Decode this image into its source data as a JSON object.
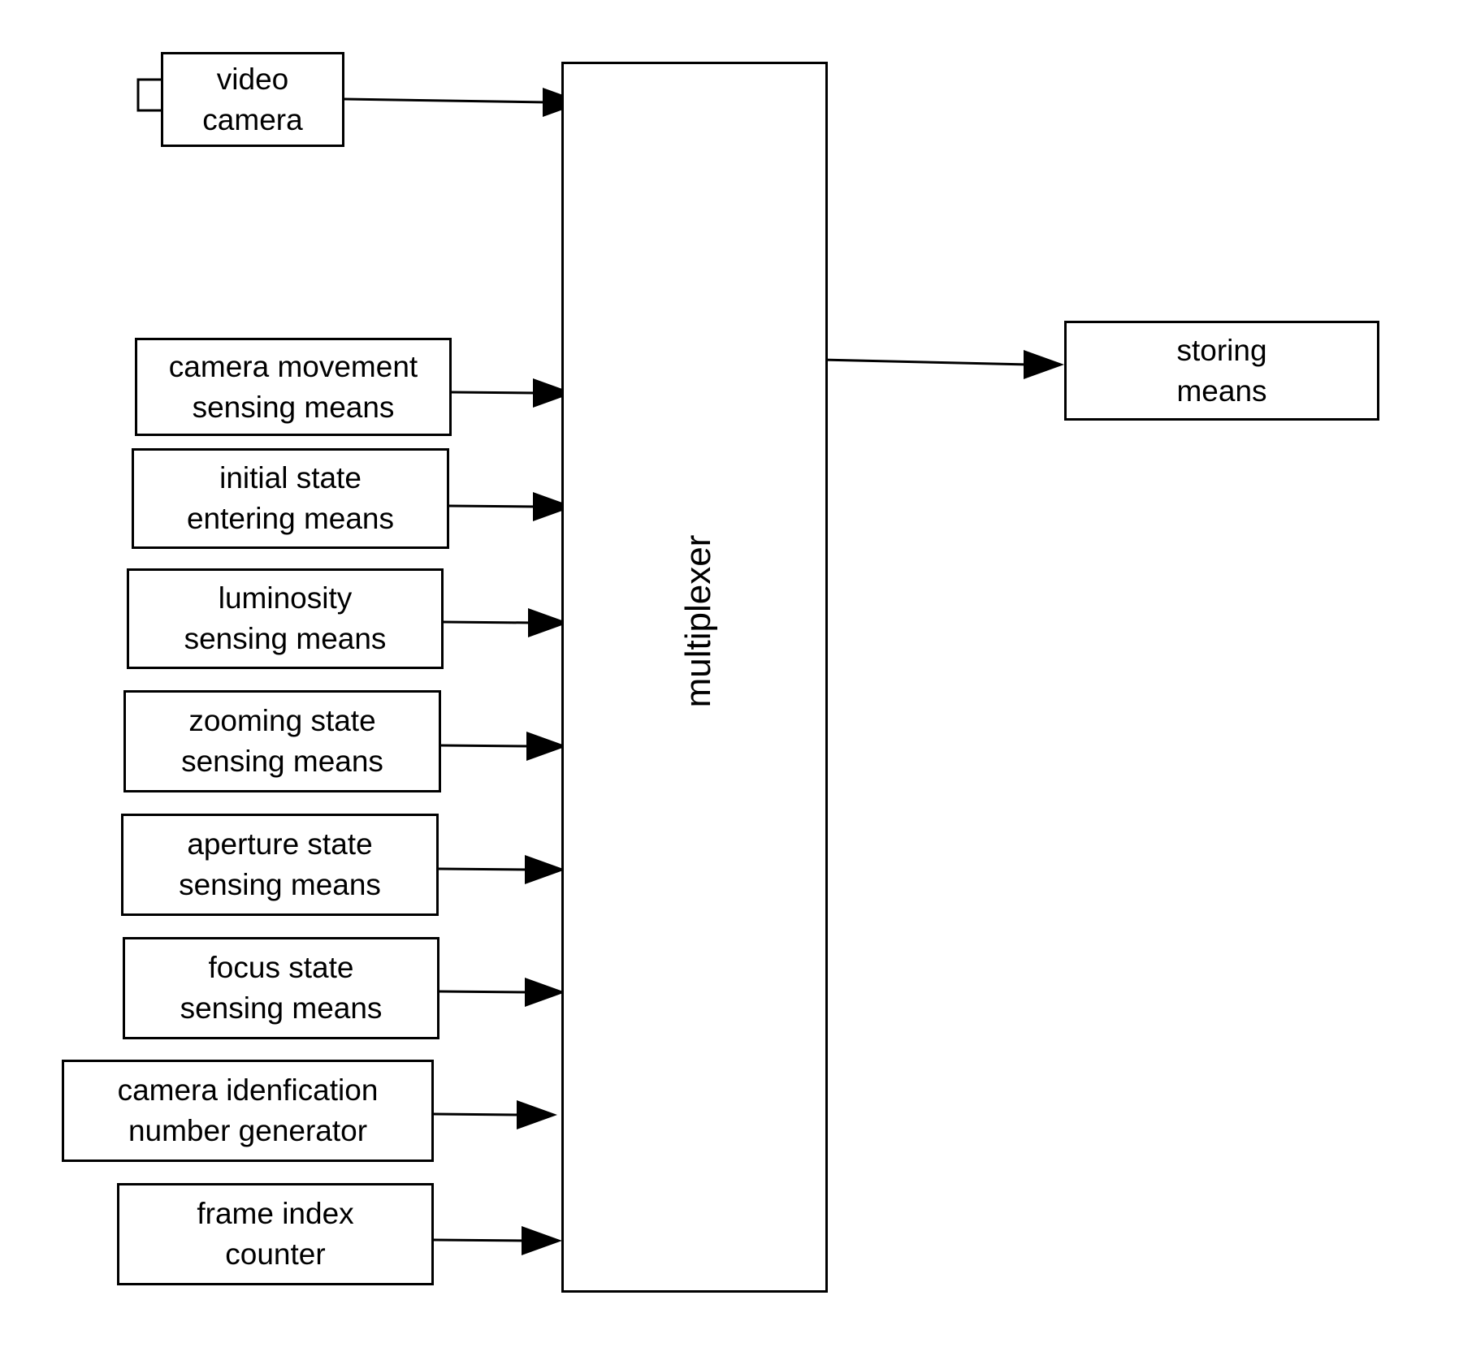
{
  "diagram": {
    "source": {
      "id": "video-camera",
      "lines": [
        "video",
        "camera"
      ],
      "icon": "camera-lens-icon"
    },
    "inputs": [
      {
        "id": "camera-movement-sensing-means",
        "lines": [
          "camera movement",
          "sensing means"
        ]
      },
      {
        "id": "initial-state-entering-means",
        "lines": [
          "initial state",
          "entering means"
        ]
      },
      {
        "id": "luminosity-sensing-means",
        "lines": [
          "luminosity",
          "sensing means"
        ]
      },
      {
        "id": "zooming-state-sensing-means",
        "lines": [
          "zooming state",
          "sensing means"
        ]
      },
      {
        "id": "aperture-state-sensing-means",
        "lines": [
          "aperture state",
          "sensing means"
        ]
      },
      {
        "id": "focus-state-sensing-means",
        "lines": [
          "focus state",
          "sensing means"
        ]
      },
      {
        "id": "camera-idenfication-number-generator",
        "lines": [
          "camera idenfication",
          "number generator"
        ]
      },
      {
        "id": "frame-index-counter",
        "lines": [
          "frame index",
          "counter"
        ]
      }
    ],
    "hub": {
      "id": "multiplexer",
      "label": "multiplexer"
    },
    "output": {
      "id": "storing-means",
      "lines": [
        "storing",
        "means"
      ]
    },
    "edges": [
      {
        "from": "video-camera",
        "to": "multiplexer"
      },
      {
        "from": "camera-movement-sensing-means",
        "to": "multiplexer"
      },
      {
        "from": "initial-state-entering-means",
        "to": "multiplexer"
      },
      {
        "from": "luminosity-sensing-means",
        "to": "multiplexer"
      },
      {
        "from": "zooming-state-sensing-means",
        "to": "multiplexer"
      },
      {
        "from": "aperture-state-sensing-means",
        "to": "multiplexer"
      },
      {
        "from": "focus-state-sensing-means",
        "to": "multiplexer"
      },
      {
        "from": "camera-idenfication-number-generator",
        "to": "multiplexer"
      },
      {
        "from": "frame-index-counter",
        "to": "multiplexer"
      },
      {
        "from": "multiplexer",
        "to": "storing-means"
      }
    ]
  }
}
